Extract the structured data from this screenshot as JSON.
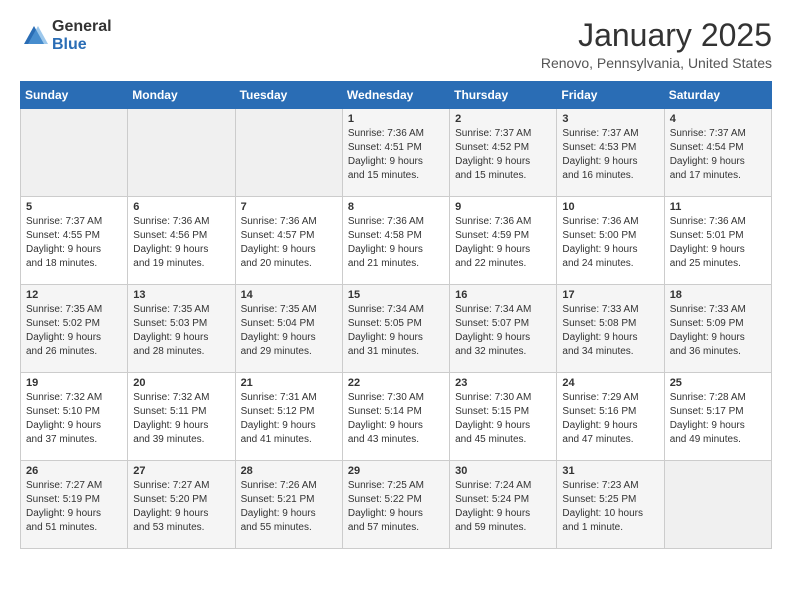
{
  "header": {
    "logo_general": "General",
    "logo_blue": "Blue",
    "month_title": "January 2025",
    "location": "Renovo, Pennsylvania, United States"
  },
  "days_of_week": [
    "Sunday",
    "Monday",
    "Tuesday",
    "Wednesday",
    "Thursday",
    "Friday",
    "Saturday"
  ],
  "weeks": [
    [
      {
        "day": "",
        "content": ""
      },
      {
        "day": "",
        "content": ""
      },
      {
        "day": "",
        "content": ""
      },
      {
        "day": "1",
        "content": "Sunrise: 7:36 AM\nSunset: 4:51 PM\nDaylight: 9 hours\nand 15 minutes."
      },
      {
        "day": "2",
        "content": "Sunrise: 7:37 AM\nSunset: 4:52 PM\nDaylight: 9 hours\nand 15 minutes."
      },
      {
        "day": "3",
        "content": "Sunrise: 7:37 AM\nSunset: 4:53 PM\nDaylight: 9 hours\nand 16 minutes."
      },
      {
        "day": "4",
        "content": "Sunrise: 7:37 AM\nSunset: 4:54 PM\nDaylight: 9 hours\nand 17 minutes."
      }
    ],
    [
      {
        "day": "5",
        "content": "Sunrise: 7:37 AM\nSunset: 4:55 PM\nDaylight: 9 hours\nand 18 minutes."
      },
      {
        "day": "6",
        "content": "Sunrise: 7:36 AM\nSunset: 4:56 PM\nDaylight: 9 hours\nand 19 minutes."
      },
      {
        "day": "7",
        "content": "Sunrise: 7:36 AM\nSunset: 4:57 PM\nDaylight: 9 hours\nand 20 minutes."
      },
      {
        "day": "8",
        "content": "Sunrise: 7:36 AM\nSunset: 4:58 PM\nDaylight: 9 hours\nand 21 minutes."
      },
      {
        "day": "9",
        "content": "Sunrise: 7:36 AM\nSunset: 4:59 PM\nDaylight: 9 hours\nand 22 minutes."
      },
      {
        "day": "10",
        "content": "Sunrise: 7:36 AM\nSunset: 5:00 PM\nDaylight: 9 hours\nand 24 minutes."
      },
      {
        "day": "11",
        "content": "Sunrise: 7:36 AM\nSunset: 5:01 PM\nDaylight: 9 hours\nand 25 minutes."
      }
    ],
    [
      {
        "day": "12",
        "content": "Sunrise: 7:35 AM\nSunset: 5:02 PM\nDaylight: 9 hours\nand 26 minutes."
      },
      {
        "day": "13",
        "content": "Sunrise: 7:35 AM\nSunset: 5:03 PM\nDaylight: 9 hours\nand 28 minutes."
      },
      {
        "day": "14",
        "content": "Sunrise: 7:35 AM\nSunset: 5:04 PM\nDaylight: 9 hours\nand 29 minutes."
      },
      {
        "day": "15",
        "content": "Sunrise: 7:34 AM\nSunset: 5:05 PM\nDaylight: 9 hours\nand 31 minutes."
      },
      {
        "day": "16",
        "content": "Sunrise: 7:34 AM\nSunset: 5:07 PM\nDaylight: 9 hours\nand 32 minutes."
      },
      {
        "day": "17",
        "content": "Sunrise: 7:33 AM\nSunset: 5:08 PM\nDaylight: 9 hours\nand 34 minutes."
      },
      {
        "day": "18",
        "content": "Sunrise: 7:33 AM\nSunset: 5:09 PM\nDaylight: 9 hours\nand 36 minutes."
      }
    ],
    [
      {
        "day": "19",
        "content": "Sunrise: 7:32 AM\nSunset: 5:10 PM\nDaylight: 9 hours\nand 37 minutes."
      },
      {
        "day": "20",
        "content": "Sunrise: 7:32 AM\nSunset: 5:11 PM\nDaylight: 9 hours\nand 39 minutes."
      },
      {
        "day": "21",
        "content": "Sunrise: 7:31 AM\nSunset: 5:12 PM\nDaylight: 9 hours\nand 41 minutes."
      },
      {
        "day": "22",
        "content": "Sunrise: 7:30 AM\nSunset: 5:14 PM\nDaylight: 9 hours\nand 43 minutes."
      },
      {
        "day": "23",
        "content": "Sunrise: 7:30 AM\nSunset: 5:15 PM\nDaylight: 9 hours\nand 45 minutes."
      },
      {
        "day": "24",
        "content": "Sunrise: 7:29 AM\nSunset: 5:16 PM\nDaylight: 9 hours\nand 47 minutes."
      },
      {
        "day": "25",
        "content": "Sunrise: 7:28 AM\nSunset: 5:17 PM\nDaylight: 9 hours\nand 49 minutes."
      }
    ],
    [
      {
        "day": "26",
        "content": "Sunrise: 7:27 AM\nSunset: 5:19 PM\nDaylight: 9 hours\nand 51 minutes."
      },
      {
        "day": "27",
        "content": "Sunrise: 7:27 AM\nSunset: 5:20 PM\nDaylight: 9 hours\nand 53 minutes."
      },
      {
        "day": "28",
        "content": "Sunrise: 7:26 AM\nSunset: 5:21 PM\nDaylight: 9 hours\nand 55 minutes."
      },
      {
        "day": "29",
        "content": "Sunrise: 7:25 AM\nSunset: 5:22 PM\nDaylight: 9 hours\nand 57 minutes."
      },
      {
        "day": "30",
        "content": "Sunrise: 7:24 AM\nSunset: 5:24 PM\nDaylight: 9 hours\nand 59 minutes."
      },
      {
        "day": "31",
        "content": "Sunrise: 7:23 AM\nSunset: 5:25 PM\nDaylight: 10 hours\nand 1 minute."
      },
      {
        "day": "",
        "content": ""
      }
    ]
  ]
}
